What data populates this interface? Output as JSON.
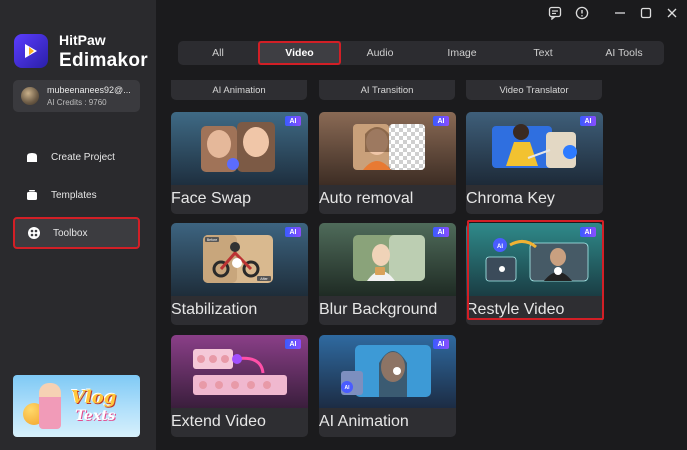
{
  "app": {
    "brand_top": "HitPaw",
    "brand_bottom": "Edimakor"
  },
  "user": {
    "name": "mubeenanees92@...",
    "credits": "AI Credits : 9760"
  },
  "nav": {
    "create_project": "Create Project",
    "templates": "Templates",
    "toolbox": "Toolbox"
  },
  "promo": {
    "line1": "Vlog",
    "line2": "Texts"
  },
  "tabs": [
    "All",
    "Video",
    "Audio",
    "Image",
    "Text",
    "AI Tools"
  ],
  "active_tab": "Video",
  "top_stubs": [
    "AI Animation",
    "AI Transition",
    "Video Translator"
  ],
  "tools": [
    {
      "label": "Face Swap",
      "badge": "AI"
    },
    {
      "label": "Auto removal",
      "badge": "AI"
    },
    {
      "label": "Chroma Key",
      "badge": "AI"
    },
    {
      "label": "Stabilization",
      "badge": "AI"
    },
    {
      "label": "Blur Background",
      "badge": "AI"
    },
    {
      "label": "Restyle Video",
      "badge": "AI"
    },
    {
      "label": "Extend Video",
      "badge": "AI"
    },
    {
      "label": "AI Animation",
      "badge": "AI"
    }
  ],
  "thumb_text": {
    "before": "Before",
    "after": "After",
    "ai": "AI"
  },
  "colors": {
    "accent_red": "#d21f26",
    "badge_blue": "#3a5bff",
    "sidebar": "#2a2a2d"
  }
}
